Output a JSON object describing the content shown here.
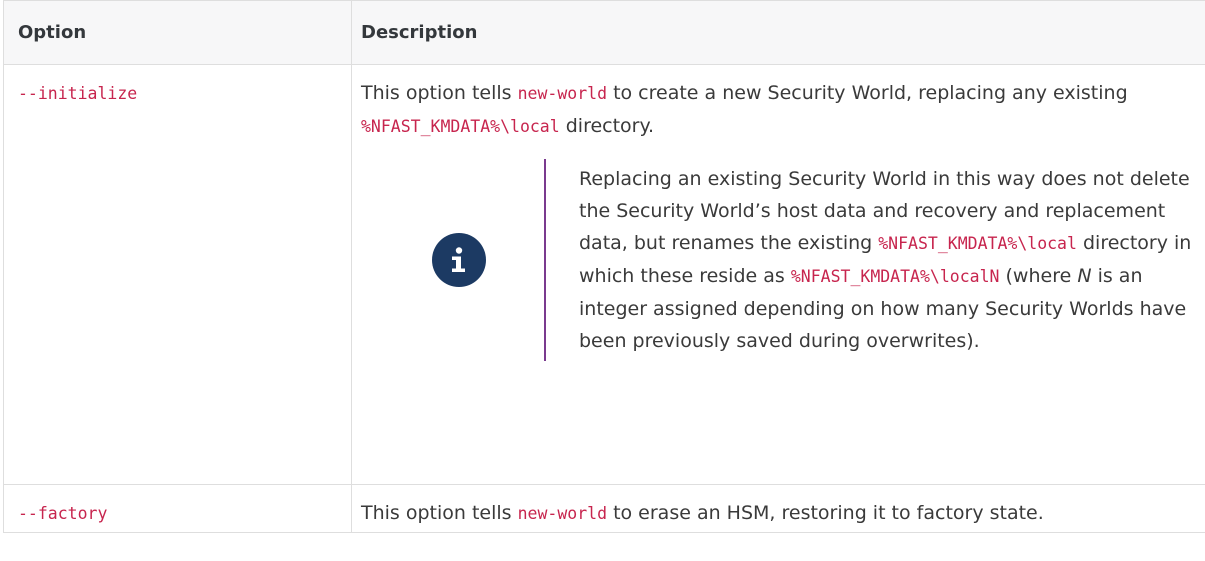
{
  "table": {
    "headers": [
      "Option",
      "Description"
    ],
    "rows": [
      {
        "option": "--initialize",
        "desc_parts": [
          "This option tells ",
          "new-world",
          " to create a new Security World, replacing any existing ",
          "%NFAST_KMDATA%\\local",
          " directory."
        ],
        "note": {
          "icon": "info-icon",
          "parts": [
            "Replacing an existing Security World in this way does not delete the Security World’s host data and recovery and replacement data, but renames the existing ",
            "%NFAST_KMDATA%\\local",
            " directory in which these reside as ",
            "%NFAST_KMDATA%\\localN",
            " (where ",
            "N",
            " is an integer assigned depending on how many Security Worlds have been previously saved during overwrites)."
          ]
        }
      },
      {
        "option": "--factory",
        "desc_parts": [
          "This option tells ",
          "new-world",
          " to erase an HSM, restoring it to factory state."
        ]
      }
    ]
  },
  "colors": {
    "code": "#c7254e",
    "note_bar": "#7a3a8e",
    "info_icon_bg": "#1c3a63",
    "header_bg": "#f7f7f8"
  }
}
